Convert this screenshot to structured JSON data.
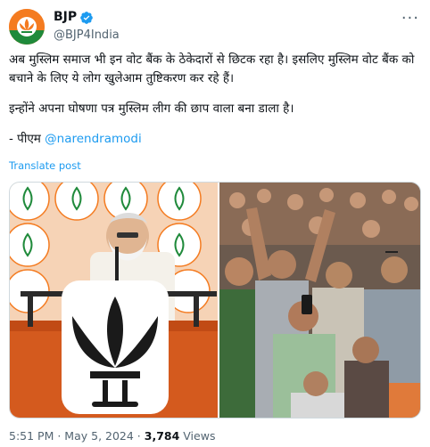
{
  "account": {
    "display_name": "BJP",
    "handle": "@BJP4India"
  },
  "tweet": {
    "line1": "अब मुस्लिम समाज भी इन वोट बैंक के ठेकेदारों से छिटक रहा है। इसलिए मुस्लिम वोट बैंक को बचाने के लिए ये लोग खुलेआम तुष्टिकरण कर रहे हैं।",
    "line2": "इन्होंने अपना घोषणा पत्र मुस्लिम लीग की छाप वाला बना डाला है।",
    "sign_prefix": "- पीएम ",
    "mention": "@narendramodi"
  },
  "translate_label": "Translate post",
  "meta": {
    "time": "5:51 PM",
    "date": "May 5, 2024",
    "views": "3,784",
    "views_label": "Views"
  },
  "colors": {
    "accent": "#1d9bf0",
    "avatar_bg": "#f47b20",
    "muted": "#536471"
  },
  "icons": {
    "verified": "verified-badge-icon",
    "more": "more-options-icon",
    "avatar_logo": "lotus-icon"
  }
}
